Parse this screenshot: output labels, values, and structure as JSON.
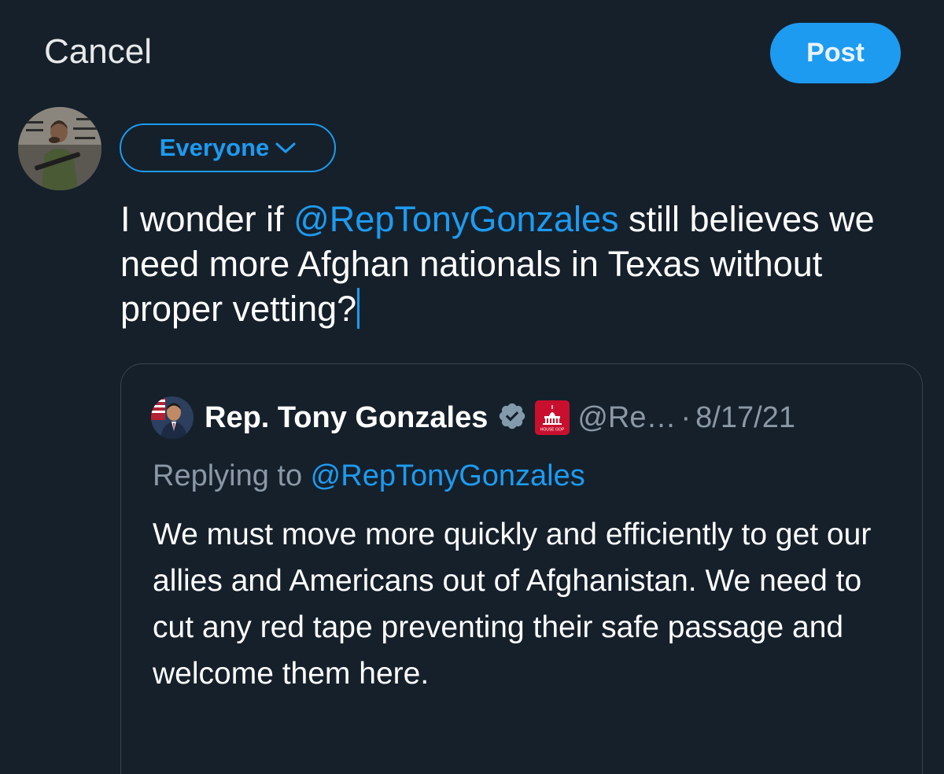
{
  "header": {
    "cancel_label": "Cancel",
    "post_label": "Post"
  },
  "composer": {
    "audience_label": "Everyone",
    "text_before": "I wonder if ",
    "mention": "@RepTonyGonzales",
    "text_after": " still believes we need more Afghan nationals in Texas without proper vetting?"
  },
  "quoted_post": {
    "author_name": "Rep. Tony Gonzales",
    "handle_truncated": "@Re…",
    "separator": "·",
    "date": "8/17/21",
    "replying_prefix": "Replying to ",
    "replying_handle": "@RepTonyGonzales",
    "body": "We must move more quickly and efficiently to get our allies and Americans out of Afghanistan. We need to cut any red tape preventing their safe passage and welcome them here.",
    "affiliation_badge_text": "HOUSE GOP"
  },
  "icons": {
    "audience": "chevron-down-icon",
    "verified": "verified-badge-icon",
    "affiliation": "house-gop-capitol-icon"
  },
  "colors": {
    "background": "#15202b",
    "accent": "#1d9bf0",
    "secondary_text": "#8b98a5",
    "border": "#38444d",
    "verified_badge": "#829aab",
    "affiliation_badge": "#c8102e"
  }
}
